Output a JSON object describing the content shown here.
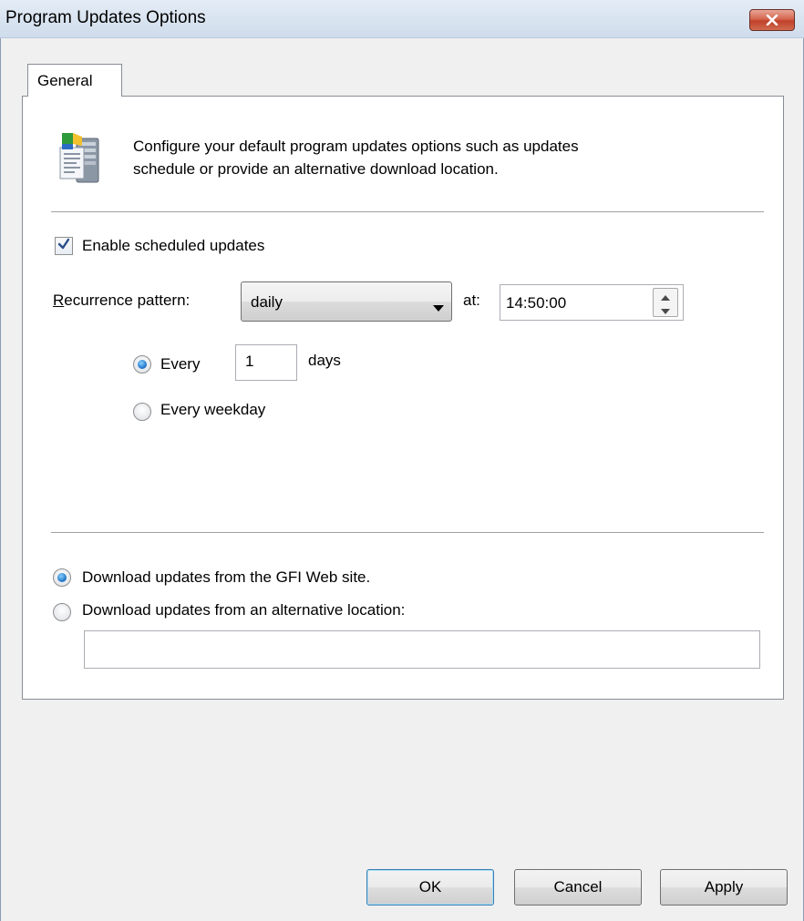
{
  "window": {
    "title": "Program Updates Options"
  },
  "tabs": [
    {
      "label": "General",
      "selected": true
    }
  ],
  "description": {
    "line1": "Configure your default program updates options such as updates",
    "line2": "schedule or provide an alternative download location."
  },
  "schedule": {
    "enable_label": "Enable scheduled updates",
    "enable_checked": true,
    "recurrence_label": "Recurrence pattern:",
    "recurrence_value": "daily",
    "at_label": "at:",
    "time_value": "14:50:00",
    "every_label": "Every",
    "every_value": "1",
    "days_label": "days",
    "weekday_label": "Every weekday",
    "selected_option": "every"
  },
  "download": {
    "gfi_label": "Download updates from the GFI Web site.",
    "alt_label": "Download updates from an alternative location:",
    "alt_value": "",
    "selected_option": "gfi"
  },
  "buttons": {
    "ok": "OK",
    "cancel": "Cancel",
    "apply": "Apply"
  },
  "icons": {
    "close": "close-icon",
    "app": "server-update-icon",
    "check": "checkmark-icon",
    "dropdown": "chevron-down-icon",
    "spin_up": "chevron-up-icon",
    "spin_down": "chevron-down-icon"
  },
  "colors": {
    "close_button": "#c2412a",
    "radio_selected": "#1a6fc4",
    "checkmark": "#2a4d8a"
  }
}
